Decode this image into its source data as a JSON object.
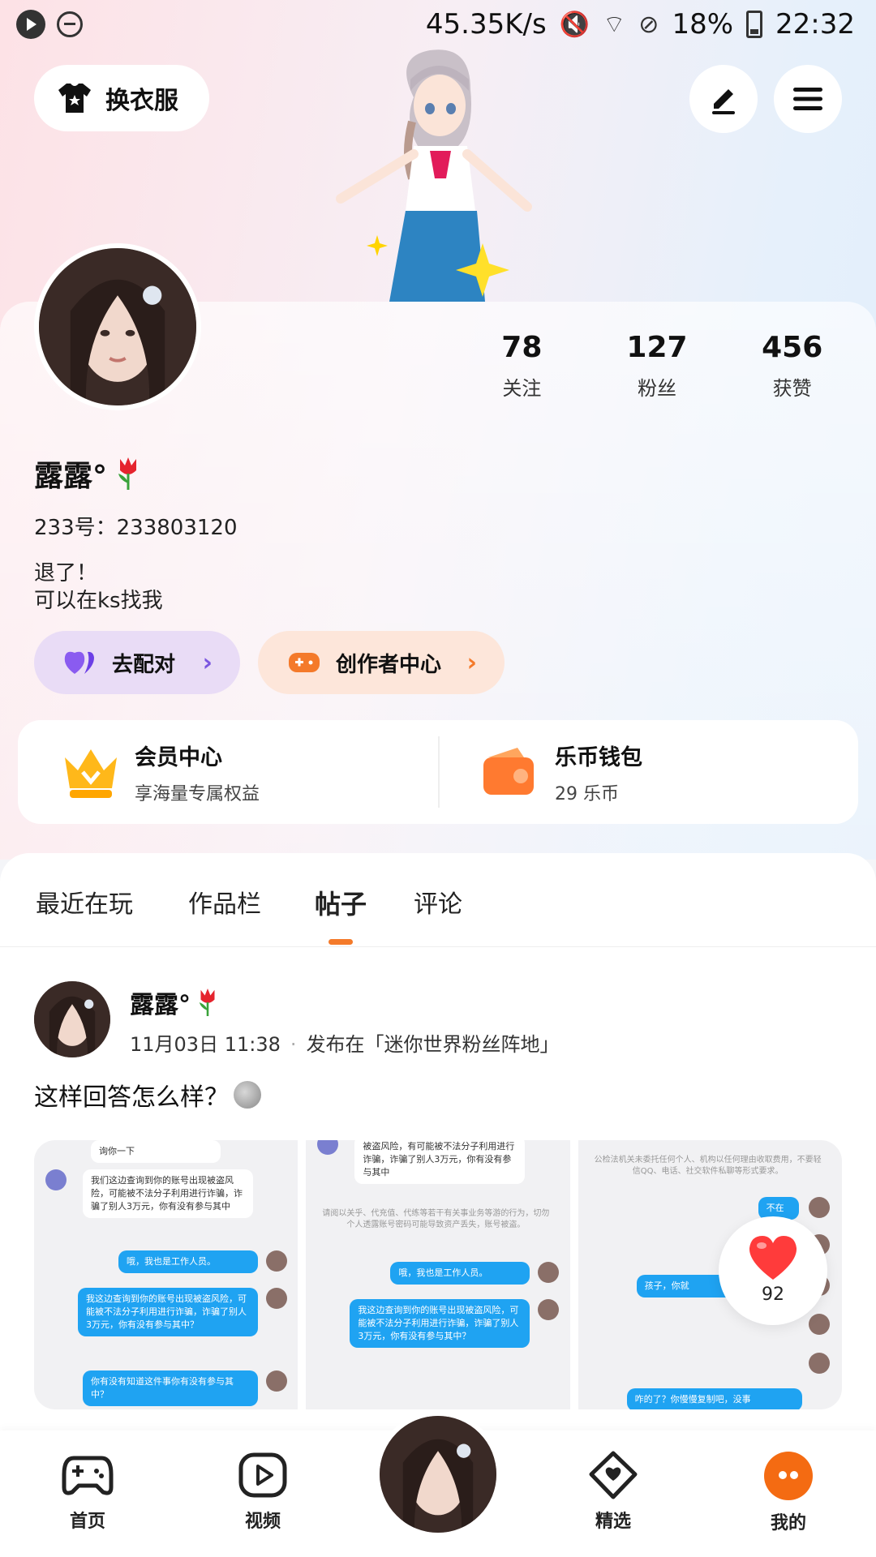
{
  "status_bar": {
    "net_speed": "45.35K/s",
    "battery": "18%",
    "time": "22:32"
  },
  "top": {
    "outfit_label": "换衣服",
    "edit_icon": "pencil-icon",
    "menu_icon": "hamburger-icon"
  },
  "stats": [
    {
      "value": "78",
      "label": "关注"
    },
    {
      "value": "127",
      "label": "粉丝"
    },
    {
      "value": "456",
      "label": "获赞"
    }
  ],
  "profile": {
    "nickname": "露露°",
    "id_line": "233号：233803120",
    "bio_line1": "退了！",
    "bio_line2": "可以在ks找我"
  },
  "pills": {
    "match_label": "去配对",
    "creator_label": "创作者中心",
    "chevron": "›"
  },
  "cards": {
    "vip_title": "会员中心",
    "vip_sub": "享海量专属权益",
    "wallet_title": "乐币钱包",
    "wallet_sub": "29 乐币"
  },
  "tabs": [
    "最近在玩",
    "作品栏",
    "帖子",
    "评论"
  ],
  "active_tab": "帖子",
  "post": {
    "author": "露露°",
    "time": "11月03日 11:38",
    "published_in": "发布在「迷你世界粉丝阵地」",
    "text": "这样回答怎么样？",
    "likes": "92"
  },
  "thumb_text": {
    "t1_top": "询你一下",
    "t1_w": "我们这边查询到你的账号出现被盗风险，可能被不法分子利用进行诈骗，诈骗了别人3万元，你有没有参与其中",
    "t1_b1": "哦，我也是工作人员。",
    "t1_b2": "我这边查询到你的账号出现被盗风险，可能被不法分子利用进行诈骗，诈骗了别人3万元，你有没有参与其中？",
    "t1_b3": "你有没有知道这件事你有没有参与其中？",
    "t2_w": "被盗风险，有可能被不法分子利用进行诈骗，诈骗了别人3万元，你有没有参与其中",
    "t2_grey": "请阅以关乎、代充值、代练等若干有关事业务等游的行为，切勿个人透露账号密码可能导致资产丢失，账号被盗。",
    "t2_b1": "哦，我也是工作人员。",
    "t2_b2": "我这边查询到你的账号出现被盗风险，可能被不法分子利用进行诈骗，诈骗了别人3万元，你有没有参与其中？",
    "t3_grey": "公检法机关未委托任何个人、机构以任何理由收取费用，不要轻信QQ、电话、社交软件私聊等形式要求。",
    "t3_b1": "不在",
    "t3_b2": "孩子，你就",
    "t3_b3": "咋的了？你慢慢复制吧，没事"
  },
  "nav": [
    {
      "label": "首页",
      "icon": "gamepad-icon"
    },
    {
      "label": "视频",
      "icon": "play-icon"
    },
    {
      "label": "精选",
      "icon": "heart-box-icon"
    },
    {
      "label": "我的",
      "icon": "me-icon"
    }
  ],
  "colors": {
    "accent": "#f47a2a",
    "chat_blue": "#1fa3f2",
    "match_bg": "#e9dcf6",
    "creator_bg": "#fde6da"
  }
}
